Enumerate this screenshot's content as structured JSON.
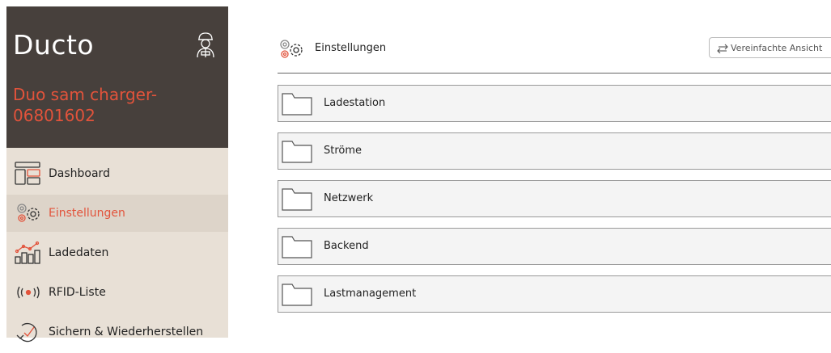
{
  "sidebar": {
    "brand": "Ducto",
    "device_name": "Duo sam charger-06801602",
    "items": [
      {
        "label": "Dashboard",
        "icon": "dashboard-icon"
      },
      {
        "label": "Einstellungen",
        "icon": "settings-gears-icon",
        "active": true
      },
      {
        "label": "Ladedaten",
        "icon": "chart-icon"
      },
      {
        "label": "RFID-Liste",
        "icon": "rfid-icon"
      },
      {
        "label": "Sichern & Wiederherstellen",
        "icon": "restore-icon"
      }
    ]
  },
  "header": {
    "title": "Einstellungen",
    "simple_view_label": "Vereinfachte Ansicht"
  },
  "folders": [
    {
      "label": "Ladestation"
    },
    {
      "label": "Ströme"
    },
    {
      "label": "Netzwerk"
    },
    {
      "label": "Backend"
    },
    {
      "label": "Lastmanagement"
    }
  ],
  "colors": {
    "accent": "#e2533b",
    "brand_bg": "#47403c",
    "sidebar_bg": "#e8e0d6"
  }
}
